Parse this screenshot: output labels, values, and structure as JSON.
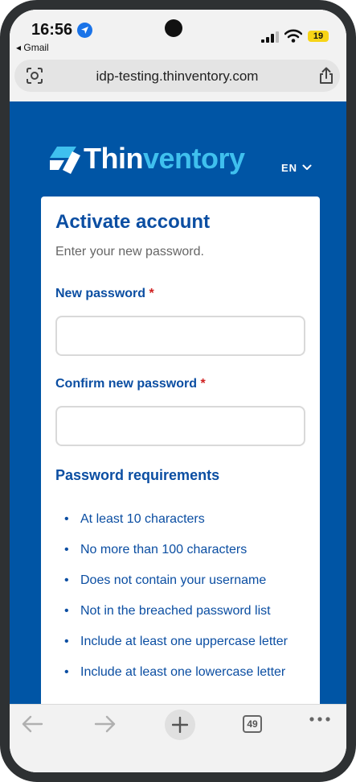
{
  "status_bar": {
    "time": "16:56",
    "back_app": "◂ Gmail",
    "battery": "19",
    "icons": [
      "location-arrow-icon",
      "signal-icon",
      "wifi-icon",
      "battery-icon"
    ]
  },
  "browser": {
    "url": "idp-testing.thinventory.com",
    "tab_count": "49",
    "icons": [
      "lens-icon",
      "share-icon",
      "back-icon",
      "forward-icon",
      "plus-icon",
      "tabs-icon",
      "more-icon"
    ]
  },
  "page": {
    "logo": {
      "part1": "Thin",
      "part2": "ventory"
    },
    "language": "EN",
    "title": "Activate account",
    "subtitle": "Enter your new password.",
    "fields": [
      {
        "label": "New password",
        "required_mark": "*",
        "value": ""
      },
      {
        "label": "Confirm new password",
        "required_mark": "*",
        "value": ""
      }
    ],
    "requirements_title": "Password requirements",
    "requirements": [
      "At least 10 characters",
      "No more than 100 characters",
      "Does not contain your username",
      "Not in the breached password list",
      "Include at least one uppercase letter",
      "Include at least one lowercase letter"
    ]
  },
  "colors": {
    "page_background": "#0055a5",
    "brand_blue": "#0b4ea2",
    "logo_accent": "#3fc0ee",
    "required": "#d02020"
  }
}
